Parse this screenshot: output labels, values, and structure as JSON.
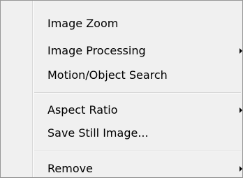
{
  "menu": {
    "items": [
      {
        "label": "Image Zoom",
        "submenu": false
      },
      {
        "label": "Image Processing",
        "submenu": true
      },
      {
        "label": "Motion/Object Search",
        "submenu": false
      },
      {
        "label": "Aspect Ratio",
        "submenu": true
      },
      {
        "label": "Save Still Image...",
        "submenu": false
      },
      {
        "label": "Remove",
        "submenu": true
      }
    ]
  }
}
